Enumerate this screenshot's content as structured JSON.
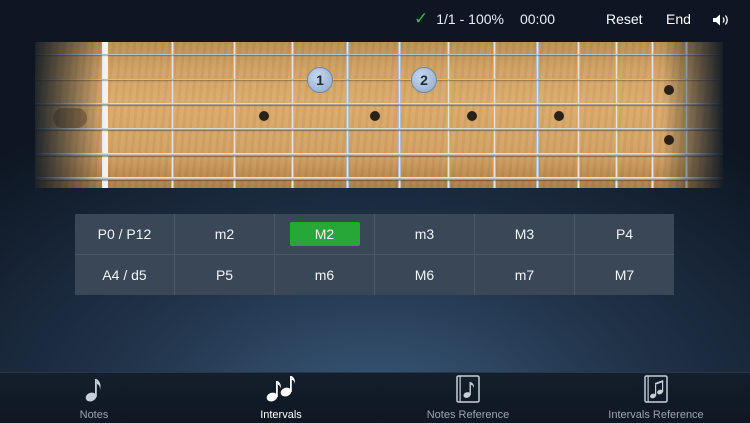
{
  "status": {
    "score": "1/1 - 100%",
    "time": "00:00"
  },
  "toolbar": {
    "reset_label": "Reset",
    "end_label": "End"
  },
  "fretboard": {
    "markers": [
      "1",
      "2"
    ]
  },
  "intervals": {
    "options": [
      "P0 / P12",
      "m2",
      "M2",
      "m3",
      "M3",
      "P4",
      "A4 / d5",
      "P5",
      "m6",
      "M6",
      "m7",
      "M7"
    ],
    "selected": "M2"
  },
  "tabs": [
    {
      "label": "Notes",
      "icon": "single-note-icon"
    },
    {
      "label": "Intervals",
      "icon": "double-note-icon"
    },
    {
      "label": "Notes Reference",
      "icon": "note-book-icon"
    },
    {
      "label": "Intervals Reference",
      "icon": "intervals-book-icon"
    }
  ],
  "active_tab": "Intervals",
  "colors": {
    "accent_green": "#27a737",
    "check_green": "#2fbf3a",
    "marker_blue": "#8fa8c6"
  }
}
